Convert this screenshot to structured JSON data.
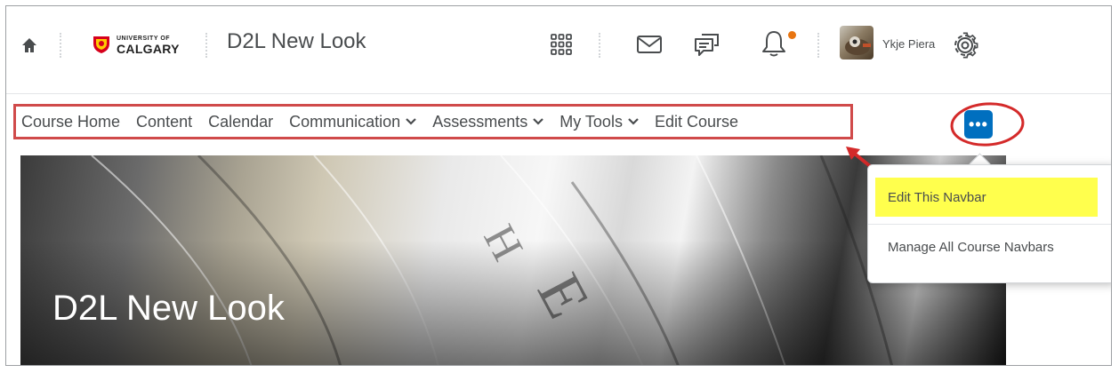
{
  "header": {
    "logo_small": "UNIVERSITY OF",
    "logo_big": "CALGARY",
    "course_title": "D2L New Look",
    "user_name": "Ykje Piera"
  },
  "navbar": {
    "items": [
      {
        "label": "Course Home"
      },
      {
        "label": "Content"
      },
      {
        "label": "Calendar"
      },
      {
        "label": "Communication"
      },
      {
        "label": "Assessments"
      },
      {
        "label": "My Tools"
      },
      {
        "label": "Edit Course"
      }
    ],
    "more_label": "•••"
  },
  "hero": {
    "title": "D2L New Look"
  },
  "dropdown": {
    "items": [
      {
        "label": "Edit This Navbar"
      },
      {
        "label": "Manage All Course Navbars"
      }
    ]
  },
  "colors": {
    "accent": "#006fbf",
    "annotation_red": "#d04a4a",
    "highlight": "#ffff4d",
    "notification": "#e87511"
  }
}
